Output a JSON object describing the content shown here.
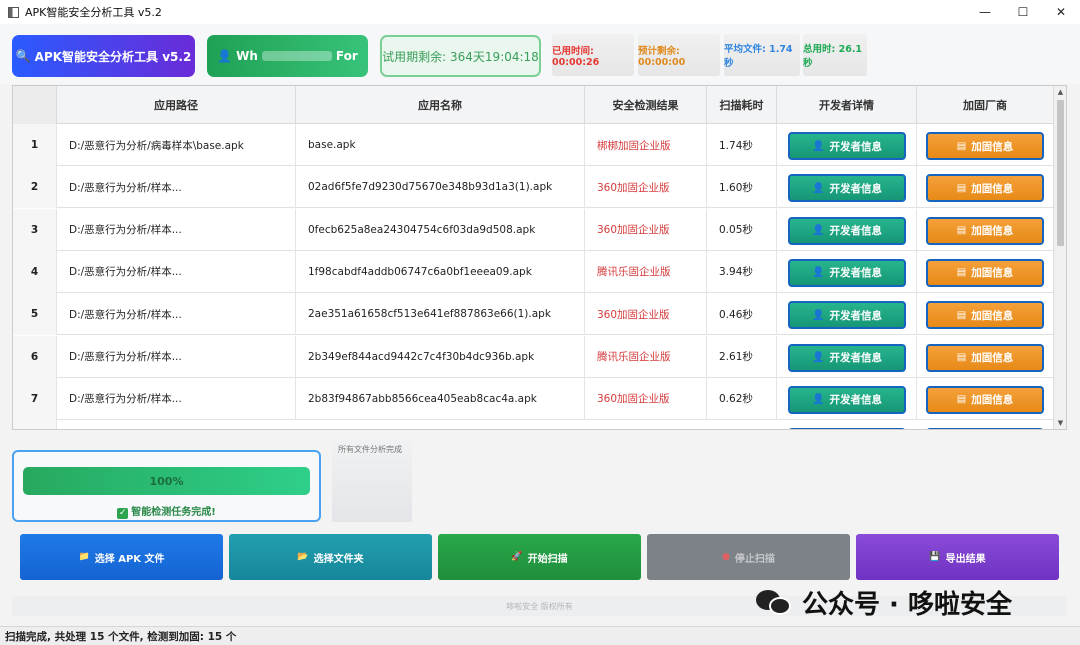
{
  "window": {
    "title": "APK智能安全分析工具 v5.2",
    "controls": {
      "minimize": "—",
      "maximize": "☐",
      "close": "✕"
    }
  },
  "header": {
    "app_badge": "APK智能安全分析工具 v5.2",
    "user_prefix": "Wh",
    "user_suffix": "For",
    "trial": "试用期剩余: 364天19:04:18",
    "elapsed": "已用时间: 00:00:26",
    "remaining": "预计剩余: 00:00:00",
    "avg": "平均文件: 1.74秒",
    "total": "总用时: 26.1秒"
  },
  "table": {
    "columns": [
      "应用路径",
      "应用名称",
      "安全检测结果",
      "扫描耗时",
      "开发者详情",
      "加固厂商"
    ],
    "dev_button_label": "开发者信息",
    "harden_button_label": "加固信息",
    "rows": [
      {
        "index": "1",
        "path": "D:/恶意行为分析/病毒样本\\base.apk",
        "name": "base.apk",
        "result": "梆梆加固企业版",
        "time": "1.74秒"
      },
      {
        "index": "2",
        "path": "D:/恶意行为分析/样本...",
        "name": "02ad6f5fe7d9230d75670e348b93d1a3(1).apk",
        "result": "360加固企业版",
        "time": "1.60秒"
      },
      {
        "index": "3",
        "path": "D:/恶意行为分析/样本...",
        "name": "0fecb625a8ea24304754c6f03da9d508.apk",
        "result": "360加固企业版",
        "time": "0.05秒"
      },
      {
        "index": "4",
        "path": "D:/恶意行为分析/样本...",
        "name": "1f98cabdf4addb06747c6a0bf1eeea09.apk",
        "result": "腾讯乐固企业版",
        "time": "3.94秒"
      },
      {
        "index": "5",
        "path": "D:/恶意行为分析/样本...",
        "name": "2ae351a61658cf513e641ef887863e66(1).apk",
        "result": "360加固企业版",
        "time": "0.46秒"
      },
      {
        "index": "6",
        "path": "D:/恶意行为分析/样本...",
        "name": "2b349ef844acd9442c7c4f30b4dc936b.apk",
        "result": "腾讯乐固企业版",
        "time": "2.61秒"
      },
      {
        "index": "7",
        "path": "D:/恶意行为分析/样本...",
        "name": "2b83f94867abb8566cea405eab8cac4a.apk",
        "result": "360加固企业版",
        "time": "0.62秒"
      }
    ]
  },
  "progress": {
    "value": 100,
    "label": "100%",
    "status": "智能检测任务完成!"
  },
  "log": {
    "text": "所有文件分析完成"
  },
  "actions": {
    "select_apk": "选择 APK 文件",
    "select_folder": "选择文件夹",
    "start_scan": "开始扫描",
    "stop_scan": "停止扫描",
    "export": "导出结果"
  },
  "footer": {
    "copyright": "哆啦安全 版权所有"
  },
  "watermark": {
    "text": "公众号 · 哆啦安全"
  },
  "statusbar": {
    "text": "扫描完成, 共处理 15 个文件, 检测到加固: 15 个"
  },
  "colors": {
    "accent_blue": "#2a5bff",
    "success_green": "#27a95f",
    "danger_red": "#d63b3b",
    "dev_button": "#1ea582",
    "harden_button": "#ef951f"
  },
  "icons": {
    "search": "search-icon",
    "user": "user-icon",
    "developer": "developer-icon",
    "harden": "shield-card-icon",
    "folder": "folder-icon",
    "scan": "rocket-icon",
    "stop": "stop-icon",
    "export": "save-icon",
    "check": "check-icon"
  }
}
